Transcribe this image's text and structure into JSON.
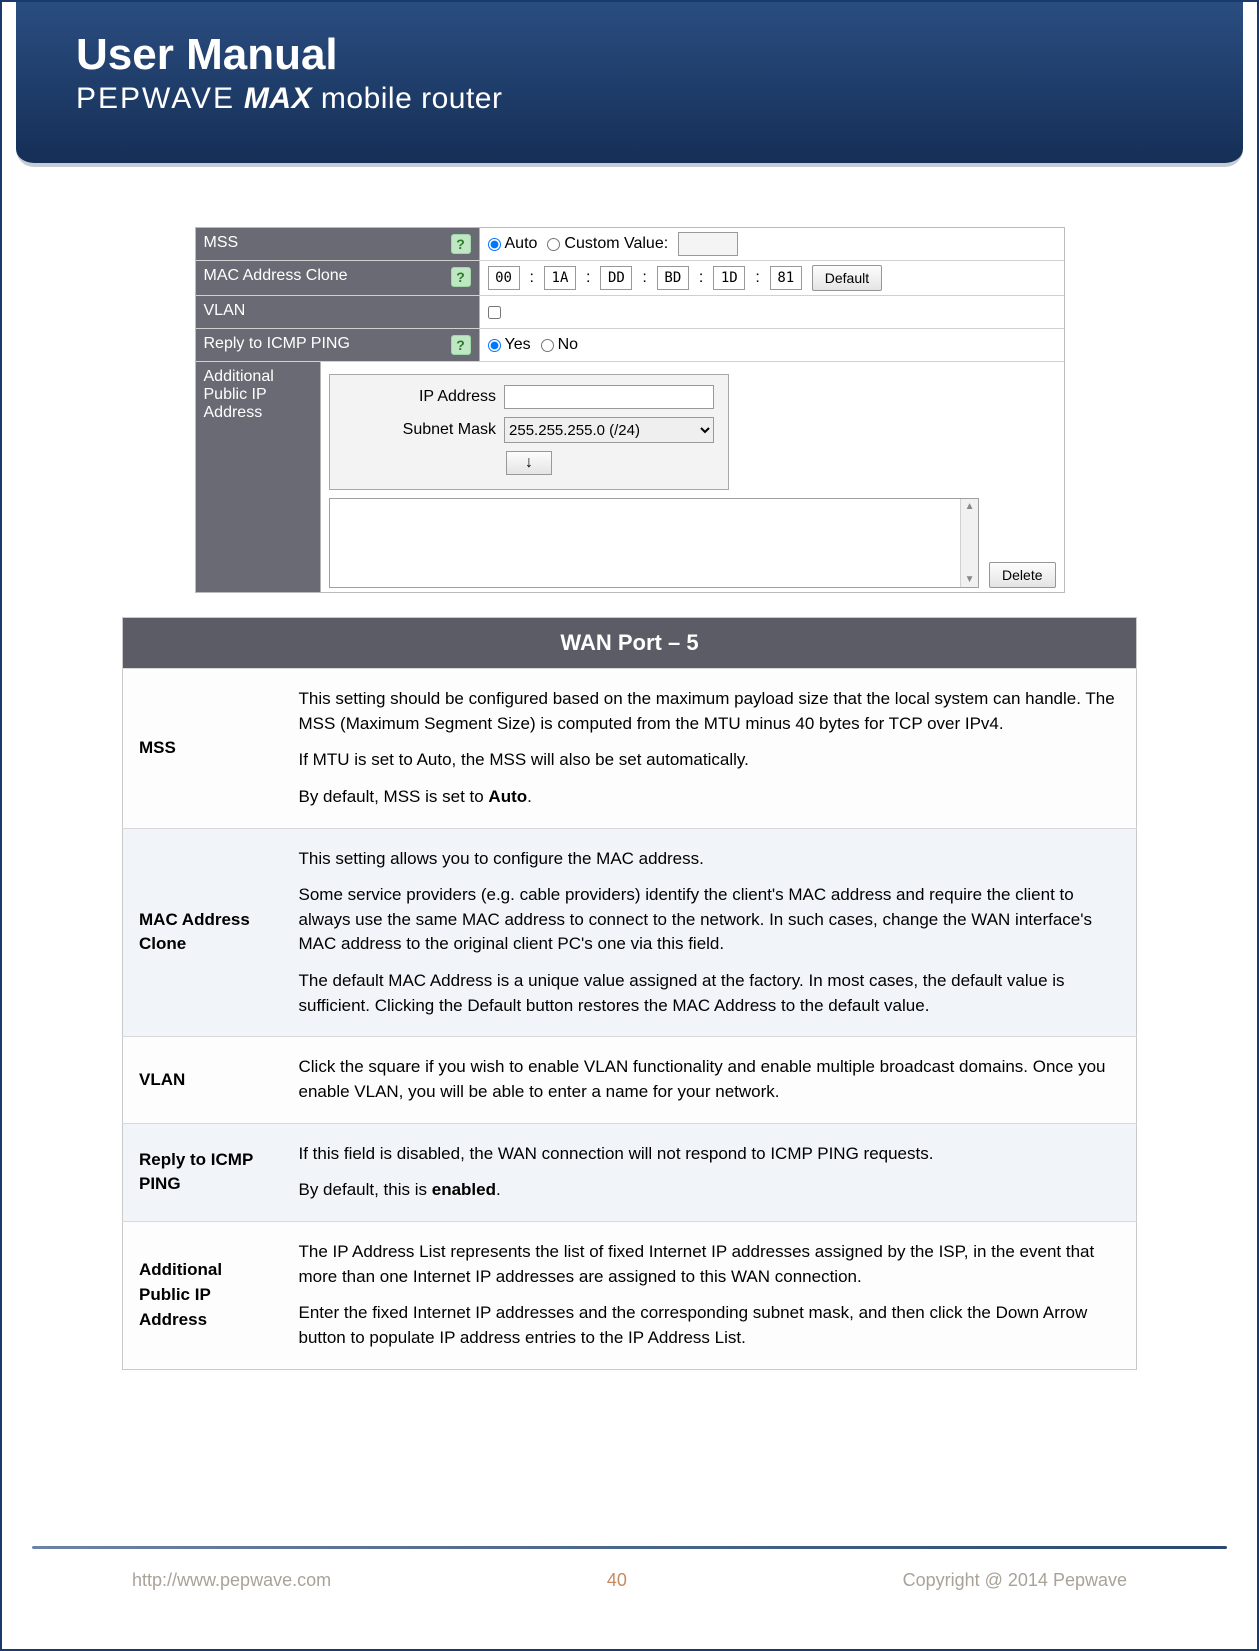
{
  "header": {
    "title": "User Manual",
    "brand": "PEPWAVE",
    "max": "MAX",
    "tail": " mobile router"
  },
  "settings": {
    "mss": {
      "label": "MSS",
      "auto_label": "Auto",
      "custom_label": "Custom Value:",
      "mode": "auto",
      "custom_value": ""
    },
    "mac_clone": {
      "label": "MAC Address Clone",
      "octets": [
        "00",
        "1A",
        "DD",
        "BD",
        "1D",
        "81"
      ],
      "default_btn": "Default"
    },
    "vlan": {
      "label": "VLAN",
      "enabled": false
    },
    "icmp": {
      "label": "Reply to ICMP PING",
      "yes_label": "Yes",
      "no_label": "No",
      "value": "yes"
    },
    "addl_ip": {
      "label": "Additional Public IP Address",
      "ip_label": "IP Address",
      "ip_value": "",
      "mask_label": "Subnet Mask",
      "mask_value": "255.255.255.0 (/24)",
      "arrow": "↓",
      "delete_btn": "Delete"
    }
  },
  "table": {
    "title": "WAN Port – 5",
    "rows": [
      {
        "key": "MSS",
        "desc": [
          "This setting should be configured based on the maximum payload size that the local system can handle. The MSS (Maximum Segment Size) is computed from the MTU minus 40 bytes for TCP over IPv4.",
          "If MTU is set to Auto, the MSS will also be set automatically.",
          "By default, MSS is set to <b>Auto</b>."
        ]
      },
      {
        "key": "MAC Address Clone",
        "desc": [
          "This setting allows you to configure the MAC address.",
          "Some service providers (e.g. cable providers) identify the client's MAC address and require the client to always use the same MAC address to connect to the network. In such cases, change the WAN interface's MAC address to the original client PC's one via this field.",
          "The default MAC Address is a unique value assigned at the factory. In most cases, the default value is sufficient.  Clicking the Default button restores the MAC Address to the default value."
        ]
      },
      {
        "key": "VLAN",
        "desc": [
          "Click the square if you wish to enable VLAN functionality and enable multiple broadcast domains. Once you enable VLAN, you will be able to enter a name for your network."
        ]
      },
      {
        "key": "Reply to ICMP PING",
        "desc": [
          "If this field is disabled, the WAN connection will not respond to ICMP PING requests.",
          "By default, this is <b>enabled</b>."
        ]
      },
      {
        "key": "Additional Public IP Address",
        "desc": [
          "The IP Address List represents the list of fixed Internet IP addresses assigned by the ISP, in the event that more than one Internet IP addresses are assigned to this WAN connection.",
          "Enter the fixed Internet IP addresses and the corresponding subnet mask, and then click the Down Arrow button to populate IP address entries to the IP Address List."
        ]
      }
    ]
  },
  "footer": {
    "url": "http://www.pepwave.com",
    "page": "40",
    "copyright": "Copyright @ 2014 Pepwave"
  }
}
